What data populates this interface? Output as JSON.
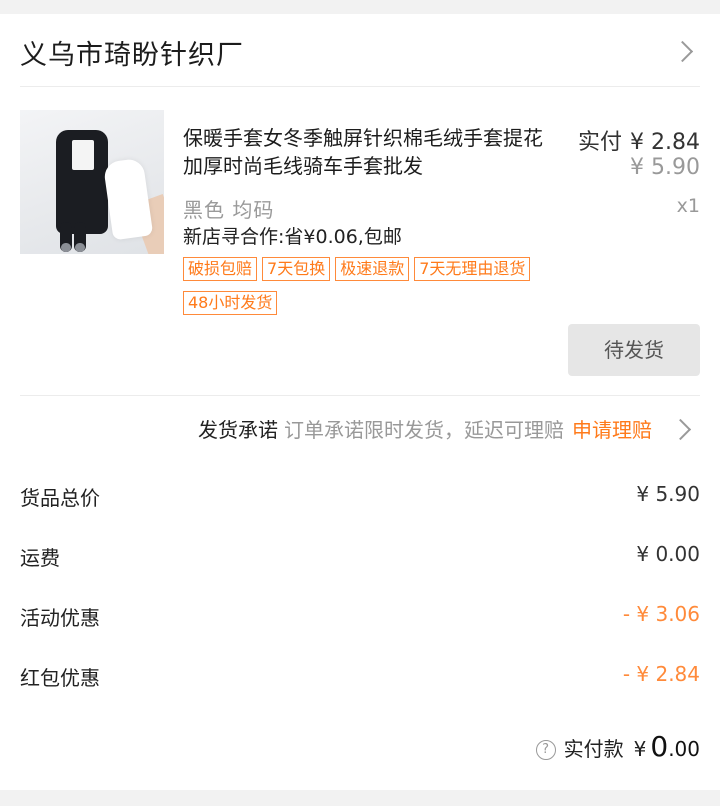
{
  "shop": {
    "name": "义乌市琦盼针织厂"
  },
  "product": {
    "title": "保暖手套女冬季触屏针织棉毛绒手套提花加厚时尚毛线骑车手套批发",
    "paid_label": "实付",
    "paid_price": "¥ 2.84",
    "original_price": "¥ 5.90",
    "quantity": "x1",
    "variant": "黑色 均码",
    "promo": "新店寻合作:省¥0.06,包邮",
    "tags": [
      "破损包赔",
      "7天包换",
      "极速退款",
      "7天无理由退货",
      "48小时发货"
    ]
  },
  "status_button": "待发货",
  "promise": {
    "title": "发货承诺",
    "description": "订单承诺限时发货，延迟可理赔",
    "claim_link": "申请理赔"
  },
  "summary": [
    {
      "label": "货品总价",
      "value": "¥ 5.90"
    },
    {
      "label": "运费",
      "value": "¥ 0.00"
    },
    {
      "label": "活动优惠",
      "value": "- ¥ 3.06"
    },
    {
      "label": "红包优惠",
      "value": "- ¥ 2.84"
    }
  ],
  "total": {
    "label": "实付款",
    "currency": "¥",
    "integer": "0",
    "decimal": ".00"
  },
  "colors": {
    "accent": "#ff7a1a",
    "discount": "#ff8a3a",
    "muted": "#999999",
    "button_bg": "#e6e6e6"
  },
  "icons": [
    "chevron-right-icon",
    "help-circle-icon"
  ]
}
